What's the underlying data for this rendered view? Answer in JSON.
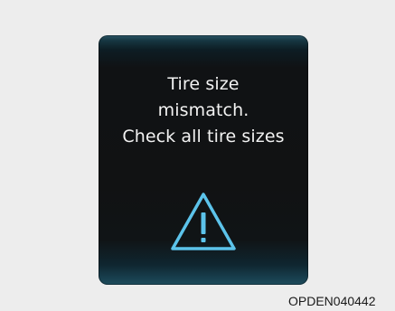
{
  "message": {
    "line1": "Tire size",
    "line2": "mismatch.",
    "line3": "Check all tire sizes"
  },
  "icon": "warning-triangle-icon",
  "colors": {
    "icon": "#5cc3ea",
    "text": "#f2f2f2",
    "background": "#ededed"
  },
  "figure_code": "OPDEN040442"
}
